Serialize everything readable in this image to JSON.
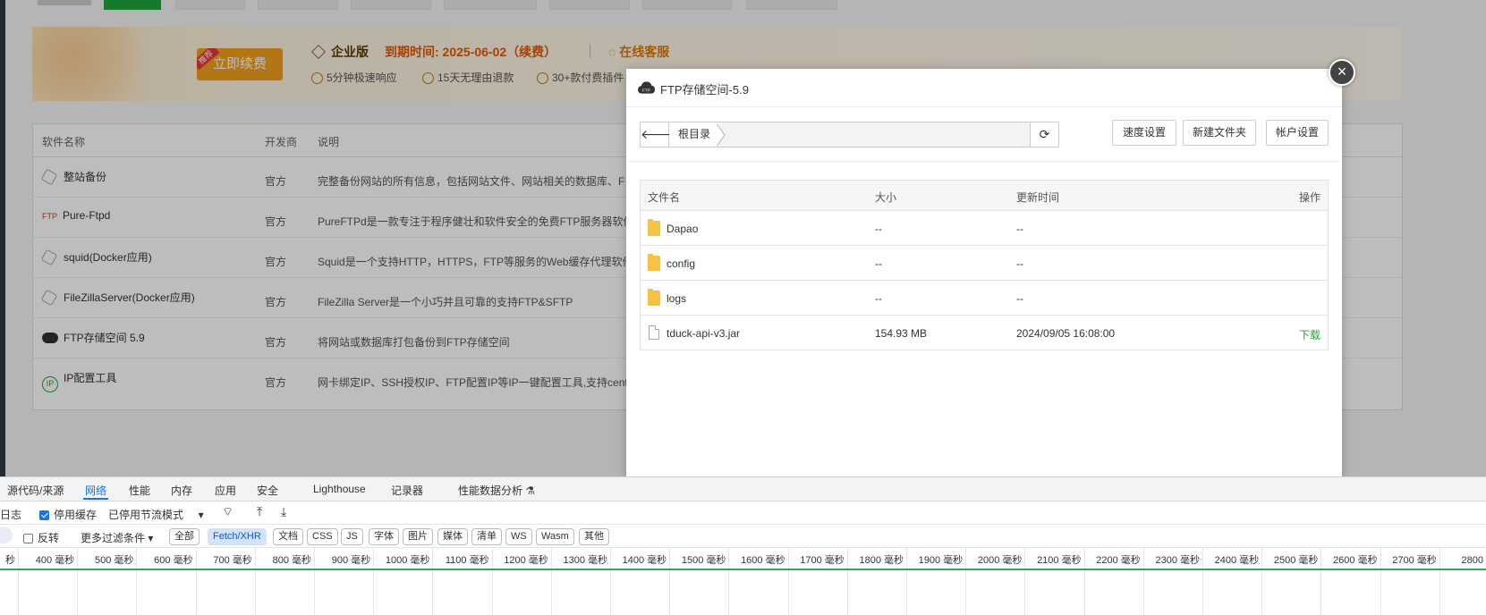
{
  "banner": {
    "renew_button": "立即续费",
    "renew_tag": "推荐",
    "edition": "企业版",
    "expire": "到期时间: 2025-06-02（续费）",
    "service": "在线客服",
    "features": [
      "5分钟极速响应",
      "15天无理由退款",
      "30+款付费插件"
    ]
  },
  "software_table": {
    "headers": {
      "name": "软件名称",
      "developer": "开发商",
      "description": "说明"
    },
    "rows": [
      {
        "name": "整站备份",
        "developer": "官方",
        "description": "完整备份网站的所有信息，包括网站文件、网站相关的数据库、F"
      },
      {
        "name": "Pure-Ftpd",
        "developer": "官方",
        "description": "PureFTPd是一款专注于程序健壮和软件安全的免费FTP服务器软件"
      },
      {
        "name": "squid(Docker应用)",
        "developer": "官方",
        "description": "Squid是一个支持HTTP，HTTPS，FTP等服务的Web缓存代理软件"
      },
      {
        "name": "FileZillaServer(Docker应用)",
        "developer": "官方",
        "description": "FileZilla Server是一个小巧并且可靠的支持FTP&SFTP"
      },
      {
        "name": "FTP存储空间 5.9",
        "developer": "官方",
        "description": "将网站或数据库打包备份到FTP存储空间"
      },
      {
        "name": "IP配置工具",
        "developer": "官方",
        "description": "网卡绑定IP、SSH授权IP、FTP配置IP等IP一键配置工具,支持cente"
      }
    ]
  },
  "modal": {
    "title": "FTP存储空间-5.9",
    "breadcrumb": "根目录",
    "buttons": {
      "speed": "速度设置",
      "new_folder": "新建文件夹",
      "account": "帐户设置"
    },
    "close": "×",
    "columns": {
      "name": "文件名",
      "size": "大小",
      "updated": "更新时间",
      "action": "操作"
    },
    "files": [
      {
        "name": "Dapao",
        "type": "folder",
        "size": "--",
        "updated": "--",
        "action": ""
      },
      {
        "name": "config",
        "type": "folder",
        "size": "--",
        "updated": "--",
        "action": ""
      },
      {
        "name": "logs",
        "type": "folder",
        "size": "--",
        "updated": "--",
        "action": ""
      },
      {
        "name": "tduck-api-v3.jar",
        "type": "file",
        "size": "154.93 MB",
        "updated": "2024/09/05 16:08:00",
        "action": "下载"
      }
    ]
  },
  "devtools": {
    "tabs": [
      "源代码/来源",
      "网络",
      "性能",
      "内存",
      "应用",
      "安全",
      "Lighthouse",
      "记录器",
      "性能数据分析"
    ],
    "active_tab": "网络",
    "row2": {
      "log": "日志",
      "disable_cache": "停用缓存",
      "throttle": "已停用节流模式"
    },
    "row3": {
      "invert": "反转",
      "more_filters": "更多过滤条件"
    },
    "filters": [
      "全部",
      "Fetch/XHR",
      "文档",
      "CSS",
      "JS",
      "字体",
      "图片",
      "媒体",
      "清单",
      "WS",
      "Wasm",
      "其他"
    ],
    "active_filter": "Fetch/XHR",
    "ticks": [
      "秒",
      "400 毫秒",
      "500 毫秒",
      "600 毫秒",
      "700 毫秒",
      "800 毫秒",
      "900 毫秒",
      "1000 毫秒",
      "1100 毫秒",
      "1200 毫秒",
      "1300 毫秒",
      "1400 毫秒",
      "1500 毫秒",
      "1600 毫秒",
      "1700 毫秒",
      "1800 毫秒",
      "1900 毫秒",
      "2000 毫秒",
      "2100 毫秒",
      "2200 毫秒",
      "2300 毫秒",
      "2400 毫秒",
      "2500 毫秒",
      "2600 毫秒",
      "2700 毫秒",
      "2800 毫"
    ]
  },
  "colors": {
    "accent_green": "#20a53a",
    "devtools_blue": "#1a73e8",
    "renew_orange": "#f0a020"
  }
}
